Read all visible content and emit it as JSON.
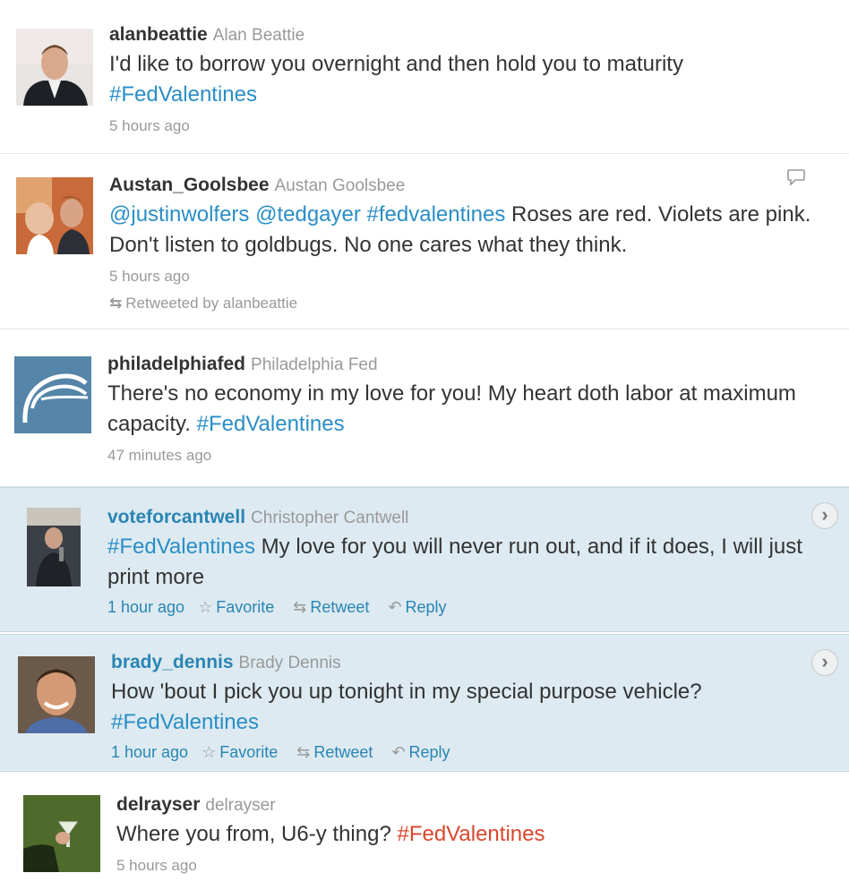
{
  "tweets": [
    {
      "screen_name": "alanbeattie",
      "real_name": "Alan Beattie",
      "text_plain": "I'd like to borrow you overnight and then hold you to maturity",
      "hashtag": "#FedValentines",
      "time": "5 hours ago"
    },
    {
      "screen_name": "Austan_Goolsbee",
      "real_name": "Austan Goolsbee",
      "mention1": "@justinwolfers",
      "mention2": "@tedgayer",
      "hashtag": "#fedvalentines",
      "text_plain": "Roses are red. Violets are pink. Don't listen to goldbugs. No one cares what they think.",
      "time": "5 hours ago",
      "retweeted_by": "Retweeted by alanbeattie",
      "reply_icon": "speech-bubble-icon"
    },
    {
      "screen_name": "philadelphiafed",
      "real_name": "Philadelphia Fed",
      "text_plain": "There's no economy in my love for you! My heart doth labor at maximum capacity.",
      "hashtag": "#FedValentines",
      "time": "47 minutes ago"
    },
    {
      "screen_name": "voteforcantwell",
      "real_name": "Christopher Cantwell",
      "hashtag": "#FedValentines",
      "text_plain": "My love for you will never run out, and if it does, I will just print more",
      "time": "1 hour ago",
      "actions": {
        "favorite": "Favorite",
        "retweet": "Retweet",
        "reply": "Reply"
      }
    },
    {
      "screen_name": "brady_dennis",
      "real_name": "Brady Dennis",
      "text_plain": "How 'bout I pick you up tonight in my special purpose vehicle?",
      "hashtag": "#FedValentines",
      "time": "1 hour ago",
      "actions": {
        "favorite": "Favorite",
        "retweet": "Retweet",
        "reply": "Reply"
      }
    },
    {
      "screen_name": "delrayser",
      "real_name": "delrayser",
      "text_plain": "Where you from, U6-y thing?",
      "hashtag": "#FedValentines",
      "time": "5 hours ago"
    }
  ],
  "colors": {
    "link": "#2a8ec5",
    "hashtag_red": "#d9472e",
    "highlight_bg": "#ddeaf1",
    "meta_gray": "#999999"
  }
}
